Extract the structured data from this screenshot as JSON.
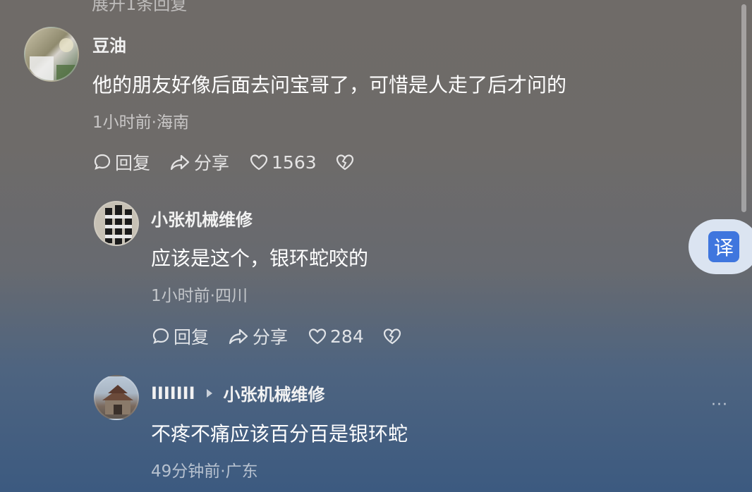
{
  "top_cut_text": "展开1条回复",
  "comments": [
    {
      "username": "豆油",
      "content": "他的朋友好像后面去问宝哥了，可惜是人走了后才问的",
      "meta": "1小时前·海南",
      "reply_label": "回复",
      "share_label": "分享",
      "likes": "1563"
    },
    {
      "username": "小张机械维修",
      "content": "应该是这个，银环蛇咬的",
      "meta": "1小时前·四川",
      "reply_label": "回复",
      "share_label": "分享",
      "likes": "284"
    },
    {
      "username": "IIIIIII",
      "reply_to": "小张机械维修",
      "content": "不疼不痛应该百分百是银环蛇",
      "meta": "49分钟前·广东",
      "more_label": "···"
    }
  ],
  "translate_button": {
    "label": "译",
    "color": "#3f76de"
  }
}
